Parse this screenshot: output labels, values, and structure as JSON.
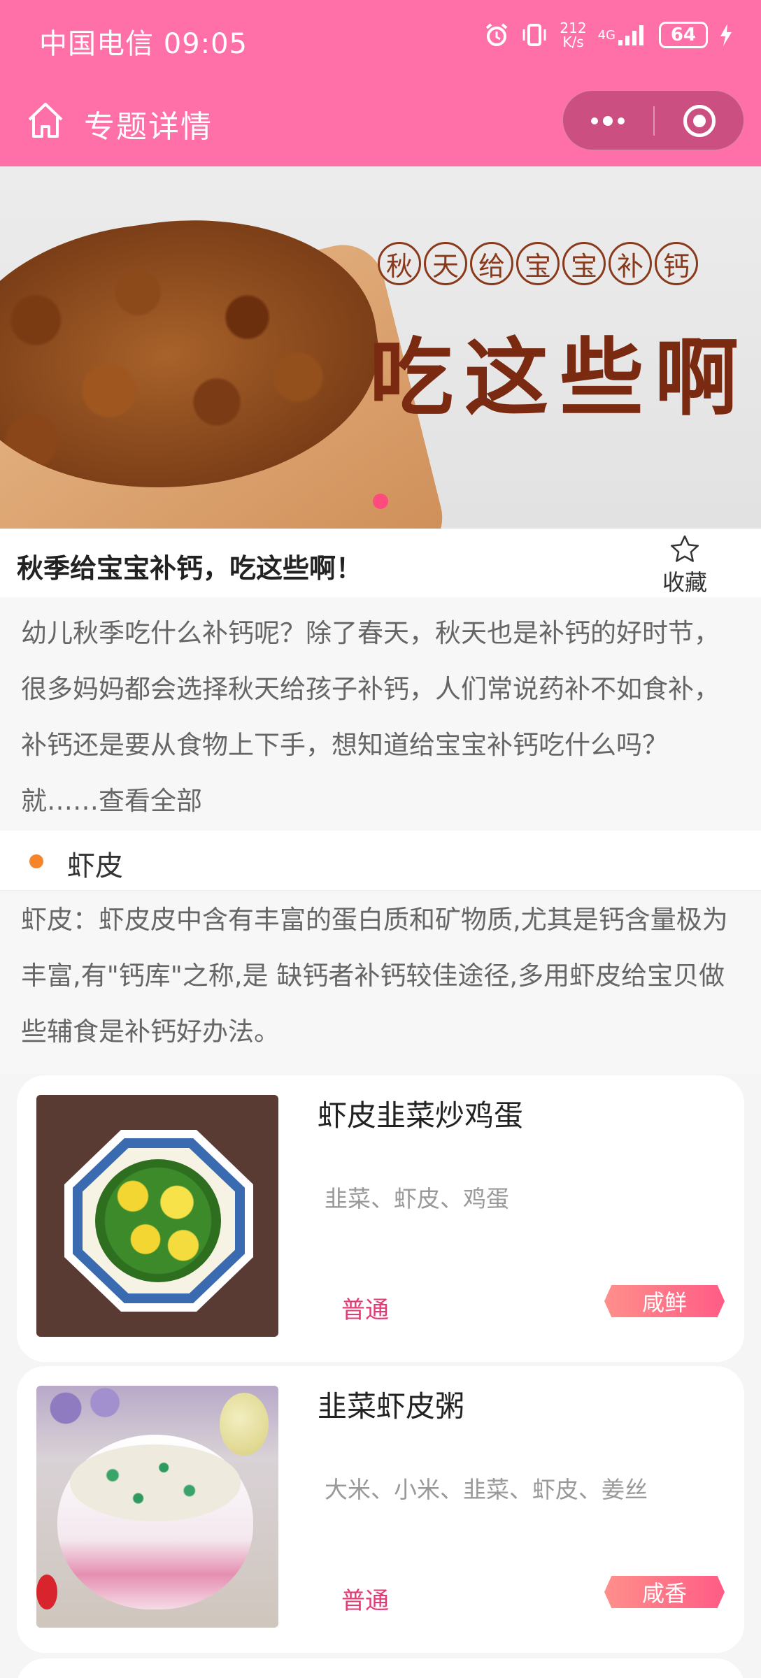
{
  "status_bar": {
    "carrier_time": "中国电信 09:05",
    "net_speed_value": "212",
    "net_speed_unit": "K/s",
    "network": "4G",
    "battery": "64",
    "icons": [
      "alarm-icon",
      "vibrate-icon",
      "signal-icon",
      "charging-icon"
    ]
  },
  "nav": {
    "title": "专题详情",
    "home_icon": "home-icon"
  },
  "banner": {
    "subtitle_chars": [
      "秋",
      "天",
      "给",
      "宝",
      "宝",
      "补",
      "钙"
    ],
    "headline": "吃这些啊"
  },
  "topic": {
    "title": "秋季给宝宝补钙，吃这些啊！",
    "favorite_label": "收藏",
    "description": "幼儿秋季吃什么补钙呢？除了春天，秋天也是补钙的好时节，很多妈妈都会选择秋天给孩子补钙，人们常说药补不如食补，补钙还是要从食物上下手，想知道给宝宝补钙吃什么吗？就……",
    "view_all": "查看全部"
  },
  "section": {
    "name": "虾皮",
    "description": "虾皮：虾皮皮中含有丰富的蛋白质和矿物质,尤其是钙含量极为丰富,有\"钙库\"之称,是 缺钙者补钙较佳途径,多用虾皮给宝贝做些辅食是补钙好办法。"
  },
  "recipes": [
    {
      "title": "虾皮韭菜炒鸡蛋",
      "ingredients": "韭菜、虾皮、鸡蛋",
      "level": "普通",
      "taste": "咸鲜"
    },
    {
      "title": "韭菜虾皮粥",
      "ingredients": "大米、小米、韭菜、虾皮、姜丝",
      "level": "普通",
      "taste": "咸香"
    }
  ],
  "colors": {
    "header": "#ff6fa8",
    "accent": "#e23a73",
    "section_dot": "#f5842b"
  }
}
